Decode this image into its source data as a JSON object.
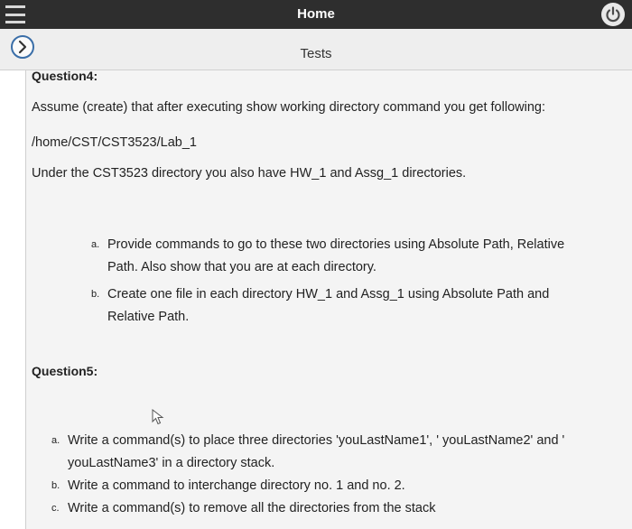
{
  "header": {
    "title": "Home",
    "menu_icon": "hamburger-menu-icon",
    "power_icon": "power-icon"
  },
  "subheader": {
    "title": "Tests",
    "back_icon": "chevron-icon"
  },
  "question4": {
    "heading": "Question4:",
    "intro": "Assume (create) that after executing show working directory command you get following:",
    "path": "/home/CST/CST3523/Lab_1",
    "note": "Under the CST3523 directory you also have HW_1 and Assg_1 directories.",
    "items": [
      {
        "marker": "a.",
        "lines": [
          "Provide commands to go to these two directories using Absolute Path, Relative",
          "Path. Also show that you are at each directory."
        ]
      },
      {
        "marker": "b.",
        "lines": [
          "Create one file in each directory HW_1 and Assg_1 using Absolute Path and",
          "Relative Path."
        ]
      }
    ]
  },
  "question5": {
    "heading": "Question5:",
    "items": [
      {
        "marker": "a.",
        "lines": [
          "Write a command(s) to place three directories 'youLastName1', ' youLastName2' and '",
          "youLastName3' in a directory stack."
        ]
      },
      {
        "marker": "b.",
        "lines": [
          "Write a command to interchange directory no. 1 and no. 2."
        ]
      },
      {
        "marker": "c.",
        "lines": [
          "Write a command(s) to remove all the directories from the stack"
        ]
      }
    ]
  },
  "colors": {
    "topbar": "#2e2e2e",
    "subbar": "#eeeeee",
    "panel": "#f4f4f4",
    "accent": "#3a6ea8"
  }
}
